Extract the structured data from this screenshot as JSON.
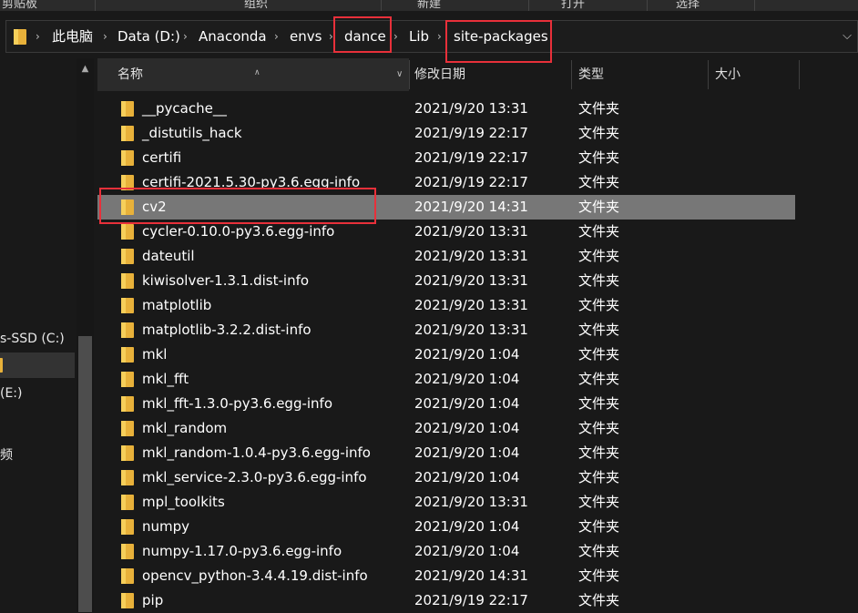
{
  "ribbon": {
    "groups": [
      "剪贴板",
      "组织",
      "新建",
      "打开",
      "选择"
    ]
  },
  "address_bar": {
    "crumbs": [
      "此电脑",
      "Data (D:)",
      "Anaconda",
      "envs",
      "dance",
      "Lib",
      "site-packages"
    ]
  },
  "nav_pane": {
    "items": [
      {
        "label": "s-SSD (C:)",
        "selected": false
      },
      {
        "label": "",
        "selected": true
      },
      {
        "label": " (E:)",
        "selected": false
      },
      {
        "label": "频",
        "selected": false
      }
    ]
  },
  "columns": {
    "name": "名称",
    "date": "修改日期",
    "type": "类型",
    "size": "大小"
  },
  "files": [
    {
      "name": "__pycache__",
      "date": "2021/9/20 13:31",
      "type": "文件夹",
      "selected": false
    },
    {
      "name": "_distutils_hack",
      "date": "2021/9/19 22:17",
      "type": "文件夹",
      "selected": false
    },
    {
      "name": "certifi",
      "date": "2021/9/19 22:17",
      "type": "文件夹",
      "selected": false
    },
    {
      "name": "certifi-2021.5.30-py3.6.egg-info",
      "date": "2021/9/19 22:17",
      "type": "文件夹",
      "selected": false
    },
    {
      "name": "cv2",
      "date": "2021/9/20 14:31",
      "type": "文件夹",
      "selected": true
    },
    {
      "name": "cycler-0.10.0-py3.6.egg-info",
      "date": "2021/9/20 13:31",
      "type": "文件夹",
      "selected": false
    },
    {
      "name": "dateutil",
      "date": "2021/9/20 13:31",
      "type": "文件夹",
      "selected": false
    },
    {
      "name": "kiwisolver-1.3.1.dist-info",
      "date": "2021/9/20 13:31",
      "type": "文件夹",
      "selected": false
    },
    {
      "name": "matplotlib",
      "date": "2021/9/20 13:31",
      "type": "文件夹",
      "selected": false
    },
    {
      "name": "matplotlib-3.2.2.dist-info",
      "date": "2021/9/20 13:31",
      "type": "文件夹",
      "selected": false
    },
    {
      "name": "mkl",
      "date": "2021/9/20 1:04",
      "type": "文件夹",
      "selected": false
    },
    {
      "name": "mkl_fft",
      "date": "2021/9/20 1:04",
      "type": "文件夹",
      "selected": false
    },
    {
      "name": "mkl_fft-1.3.0-py3.6.egg-info",
      "date": "2021/9/20 1:04",
      "type": "文件夹",
      "selected": false
    },
    {
      "name": "mkl_random",
      "date": "2021/9/20 1:04",
      "type": "文件夹",
      "selected": false
    },
    {
      "name": "mkl_random-1.0.4-py3.6.egg-info",
      "date": "2021/9/20 1:04",
      "type": "文件夹",
      "selected": false
    },
    {
      "name": "mkl_service-2.3.0-py3.6.egg-info",
      "date": "2021/9/20 1:04",
      "type": "文件夹",
      "selected": false
    },
    {
      "name": "mpl_toolkits",
      "date": "2021/9/20 13:31",
      "type": "文件夹",
      "selected": false
    },
    {
      "name": "numpy",
      "date": "2021/9/20 1:04",
      "type": "文件夹",
      "selected": false
    },
    {
      "name": "numpy-1.17.0-py3.6.egg-info",
      "date": "2021/9/20 1:04",
      "type": "文件夹",
      "selected": false
    },
    {
      "name": "opencv_python-3.4.4.19.dist-info",
      "date": "2021/9/20 14:31",
      "type": "文件夹",
      "selected": false
    },
    {
      "name": "pip",
      "date": "2021/9/19 22:17",
      "type": "文件夹",
      "selected": false
    }
  ],
  "colors": {
    "background": "#191919",
    "selected_row": "#777777",
    "folder": "#f5c542",
    "annotation": "#e8303a"
  }
}
